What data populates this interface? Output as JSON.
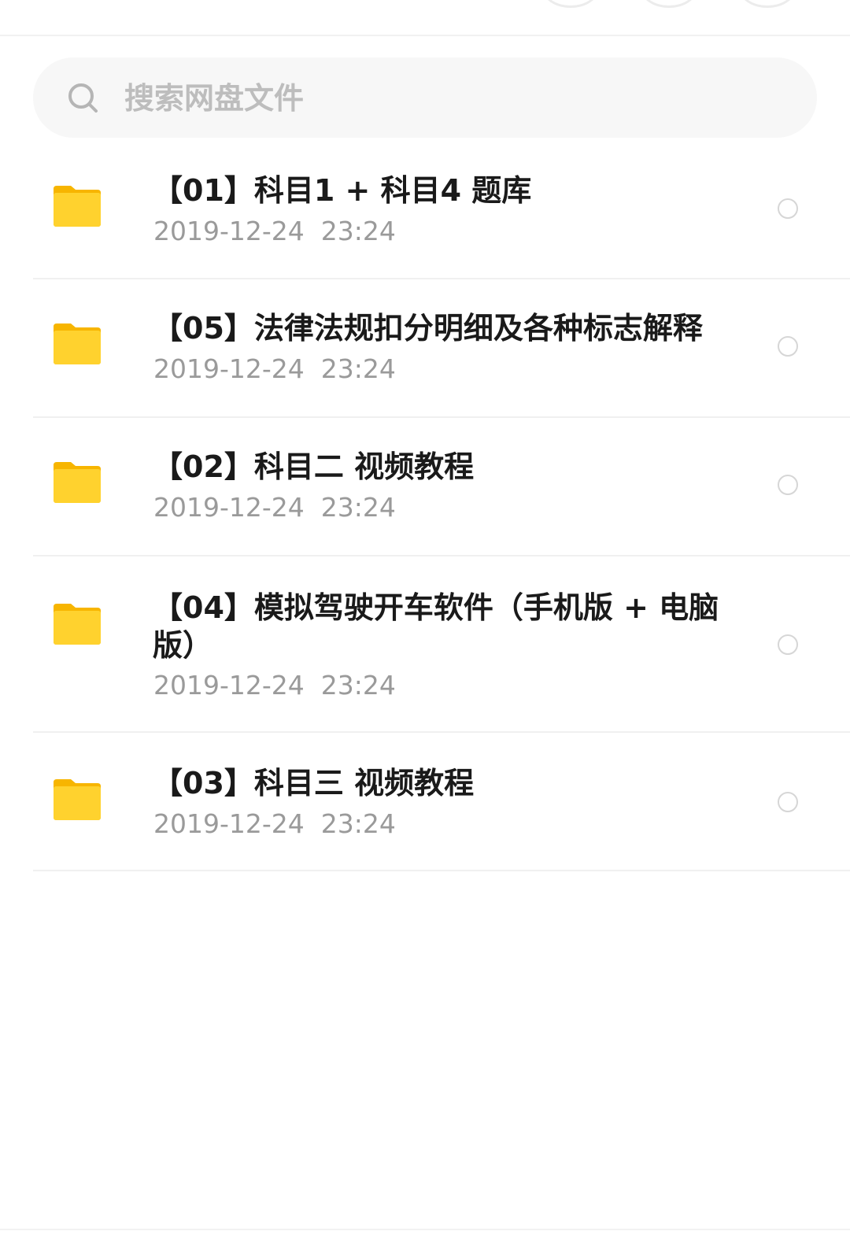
{
  "search": {
    "placeholder": "搜索网盘文件",
    "icon": "search-icon"
  },
  "colors": {
    "folder": "#FFD22E",
    "folder_tab": "#F7B500",
    "title": "#1A1A1A",
    "meta": "#9A9A9A",
    "divider": "#F0F0F0"
  },
  "files": [
    {
      "name": "【01】科目1 + 科目4 题库",
      "date": "2019-12-24  23:24",
      "icon": "folder-icon",
      "selected": false
    },
    {
      "name": "【05】法律法规扣分明细及各种标志解释",
      "date": "2019-12-24  23:24",
      "icon": "folder-icon",
      "selected": false
    },
    {
      "name": "【02】科目二 视频教程",
      "date": "2019-12-24  23:24",
      "icon": "folder-icon",
      "selected": false
    },
    {
      "name": "【04】模拟驾驶开车软件（手机版 + 电脑版）",
      "date": "2019-12-24  23:24",
      "icon": "folder-icon",
      "selected": false
    },
    {
      "name": "【03】科目三 视频教程",
      "date": "2019-12-24  23:24",
      "icon": "folder-icon",
      "selected": false
    }
  ]
}
